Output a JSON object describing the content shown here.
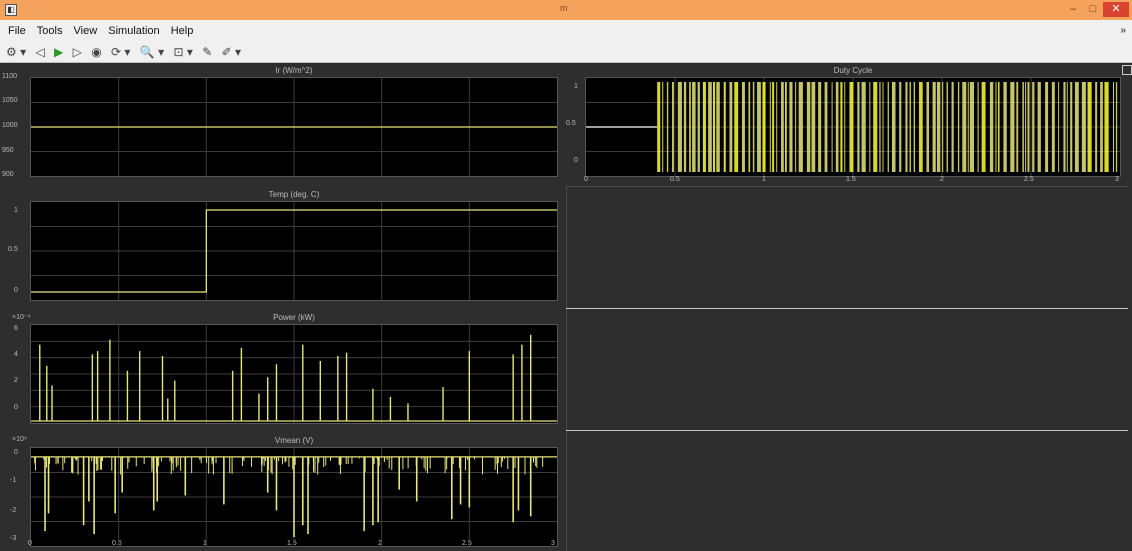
{
  "window": {
    "title": "m",
    "minimize": "–",
    "maximize": "□",
    "close": "✕",
    "app_icon": "scope-icon"
  },
  "menu": {
    "items": [
      "File",
      "Tools",
      "View",
      "Simulation",
      "Help"
    ],
    "chevron": "»"
  },
  "toolbar": {
    "items": [
      "⚙ ▾",
      "◁",
      "▶",
      "▷",
      "◉",
      "⟳ ▾",
      "🔍 ▾",
      "⊡ ▾",
      "✎",
      "✐ ▾"
    ]
  },
  "colors": {
    "trace": "#e6e67a",
    "trace_bright": "#ffff33",
    "grid": "#3c3c3c",
    "background": "#000000"
  },
  "plots": {
    "irr": {
      "title": "Ir (W/m^2)",
      "yticks": [
        "1100",
        "1050",
        "1000",
        "950",
        "900"
      ]
    },
    "temp": {
      "title": "Temp (deg. C)",
      "yticks": [
        "1",
        "0.5",
        "0"
      ]
    },
    "power": {
      "title": "Power (kW)",
      "exponent": "×10⁻⁴",
      "yticks": [
        "6",
        "4",
        "2",
        "0"
      ]
    },
    "vmean": {
      "title": "Vmean (V)",
      "exponent": "×10⁴",
      "yticks": [
        "0",
        "-1",
        "-2",
        "-3"
      ]
    },
    "duty": {
      "title": "Duty Cycle",
      "yticks": [
        "1",
        "0.5",
        "0"
      ],
      "xticks": [
        "0",
        "0.5",
        "1",
        "1.5",
        "2",
        "2.5",
        "3"
      ]
    },
    "left_xticks": [
      "0",
      "0.5",
      "1",
      "1.5",
      "2",
      "2.5",
      "3"
    ]
  },
  "chart_data": [
    {
      "type": "line",
      "title": "Ir (W/m^2)",
      "x": [
        0,
        3
      ],
      "y": [
        1000,
        1000
      ],
      "xlim": [
        0,
        3
      ],
      "ylim": [
        900,
        1100
      ],
      "grid": true
    },
    {
      "type": "line",
      "title": "Temp (deg. C)",
      "x": [
        0,
        1,
        1,
        3
      ],
      "y": [
        0,
        0,
        1,
        1
      ],
      "xlim": [
        0,
        3
      ],
      "ylim": [
        0,
        1
      ],
      "grid": true
    },
    {
      "type": "line",
      "title": "Power (kW)",
      "description_scale": "x10^-4",
      "xlim": [
        0,
        3
      ],
      "ylim": [
        0,
        6
      ],
      "grid": true,
      "baseline": 0,
      "spikes_x": [
        0.05,
        0.09,
        0.12,
        0.35,
        0.38,
        0.45,
        0.55,
        0.62,
        0.75,
        0.78,
        0.82,
        1.15,
        1.2,
        1.3,
        1.35,
        1.4,
        1.55,
        1.65,
        1.75,
        1.8,
        1.95,
        2.05,
        2.15,
        2.35,
        2.5,
        2.75,
        2.8,
        2.85
      ],
      "spikes_y": [
        4.8,
        3.5,
        2.3,
        4.2,
        4.4,
        5.1,
        3.2,
        4.4,
        4.1,
        1.5,
        2.6,
        3.2,
        4.6,
        1.8,
        2.8,
        3.6,
        4.8,
        3.8,
        4.1,
        4.3,
        2.1,
        1.6,
        1.2,
        2.2,
        4.4,
        4.2,
        4.8,
        5.4
      ]
    },
    {
      "type": "line",
      "title": "Vmean (V)",
      "description_scale": "x10^4",
      "xlim": [
        0,
        3
      ],
      "ylim": [
        -3,
        0.3
      ],
      "grid": true,
      "baseline": 0,
      "spikes_x": [
        0.08,
        0.1,
        0.3,
        0.33,
        0.36,
        0.48,
        0.52,
        0.7,
        0.72,
        0.88,
        1.1,
        1.35,
        1.4,
        1.5,
        1.55,
        1.58,
        1.9,
        1.95,
        1.98,
        2.1,
        2.2,
        2.4,
        2.45,
        2.5,
        2.75,
        2.78,
        2.85
      ],
      "spikes_y": [
        -2.5,
        -1.9,
        -2.3,
        -1.5,
        -2.6,
        -1.9,
        -1.2,
        -1.8,
        -1.5,
        -1.3,
        -1.6,
        -1.2,
        -1.8,
        -2.7,
        -2.3,
        -2.6,
        -2.5,
        -2.3,
        -2.2,
        -1.1,
        -1.5,
        -2.1,
        -1.6,
        -1.7,
        -2.2,
        -1.8,
        -2.0
      ]
    },
    {
      "type": "line",
      "title": "Duty Cycle",
      "xlim": [
        0,
        3
      ],
      "ylim": [
        0,
        1
      ],
      "grid": true,
      "initial_value": 0.5,
      "switching_start_x": 0.4,
      "switching_end_x": 3,
      "levels": [
        0,
        1
      ]
    }
  ]
}
